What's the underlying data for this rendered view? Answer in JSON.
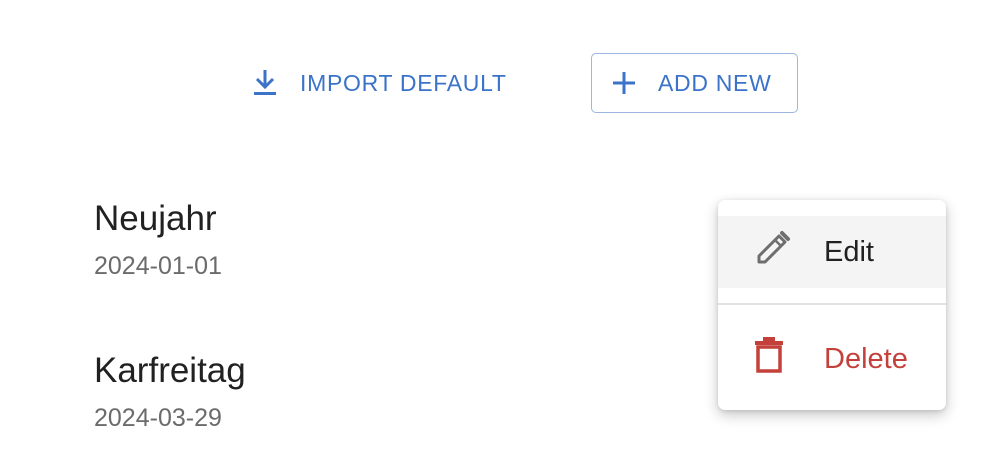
{
  "toolbar": {
    "import_label": "IMPORT DEFAULT",
    "add_label": "ADD NEW"
  },
  "holidays": [
    {
      "name": "Neujahr",
      "date": "2024-01-01"
    },
    {
      "name": "Karfreitag",
      "date": "2024-03-29"
    }
  ],
  "context_menu": {
    "edit_label": "Edit",
    "delete_label": "Delete"
  },
  "icons": {
    "import": "download-icon",
    "add": "plus-icon",
    "edit": "pencil-icon",
    "delete": "trash-icon"
  },
  "colors": {
    "accent": "#3a73c8",
    "danger": "#c4413b",
    "text_primary": "#212121",
    "text_secondary": "#6b6b6b"
  }
}
